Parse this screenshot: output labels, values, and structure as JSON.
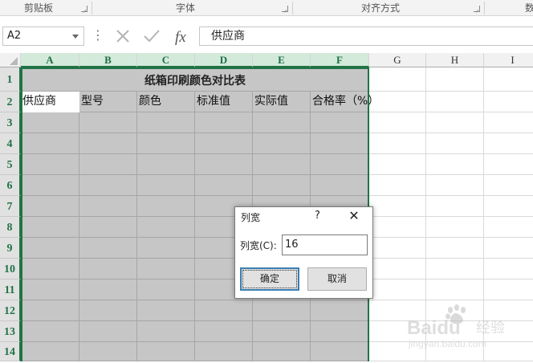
{
  "ribbon": {
    "groups": [
      "剪贴板",
      "字体",
      "对齐方式",
      "数"
    ]
  },
  "formula_bar": {
    "name_box": "A2",
    "content": "供应商"
  },
  "columns": [
    "A",
    "B",
    "C",
    "D",
    "E",
    "F",
    "G",
    "H",
    "I"
  ],
  "rows": [
    "1",
    "2",
    "3",
    "4",
    "5",
    "6",
    "7",
    "8",
    "9",
    "10",
    "11",
    "12",
    "13",
    "14"
  ],
  "sheet": {
    "title": "纸箱印刷颜色对比表",
    "headers": [
      "供应商",
      "型号",
      "颜色",
      "标准值",
      "实际值",
      "合格率（%）"
    ]
  },
  "dialog": {
    "title": "列宽",
    "help": "?",
    "close": "✕",
    "label": "列宽(C):",
    "value": "16",
    "ok": "确定",
    "cancel": "取消"
  },
  "colors": {
    "accent": "#217346",
    "selection": "#c6c6c6"
  },
  "watermark": {
    "brand": "Baidu",
    "suffix": "经验",
    "url": "jingyan.baidu.com"
  }
}
